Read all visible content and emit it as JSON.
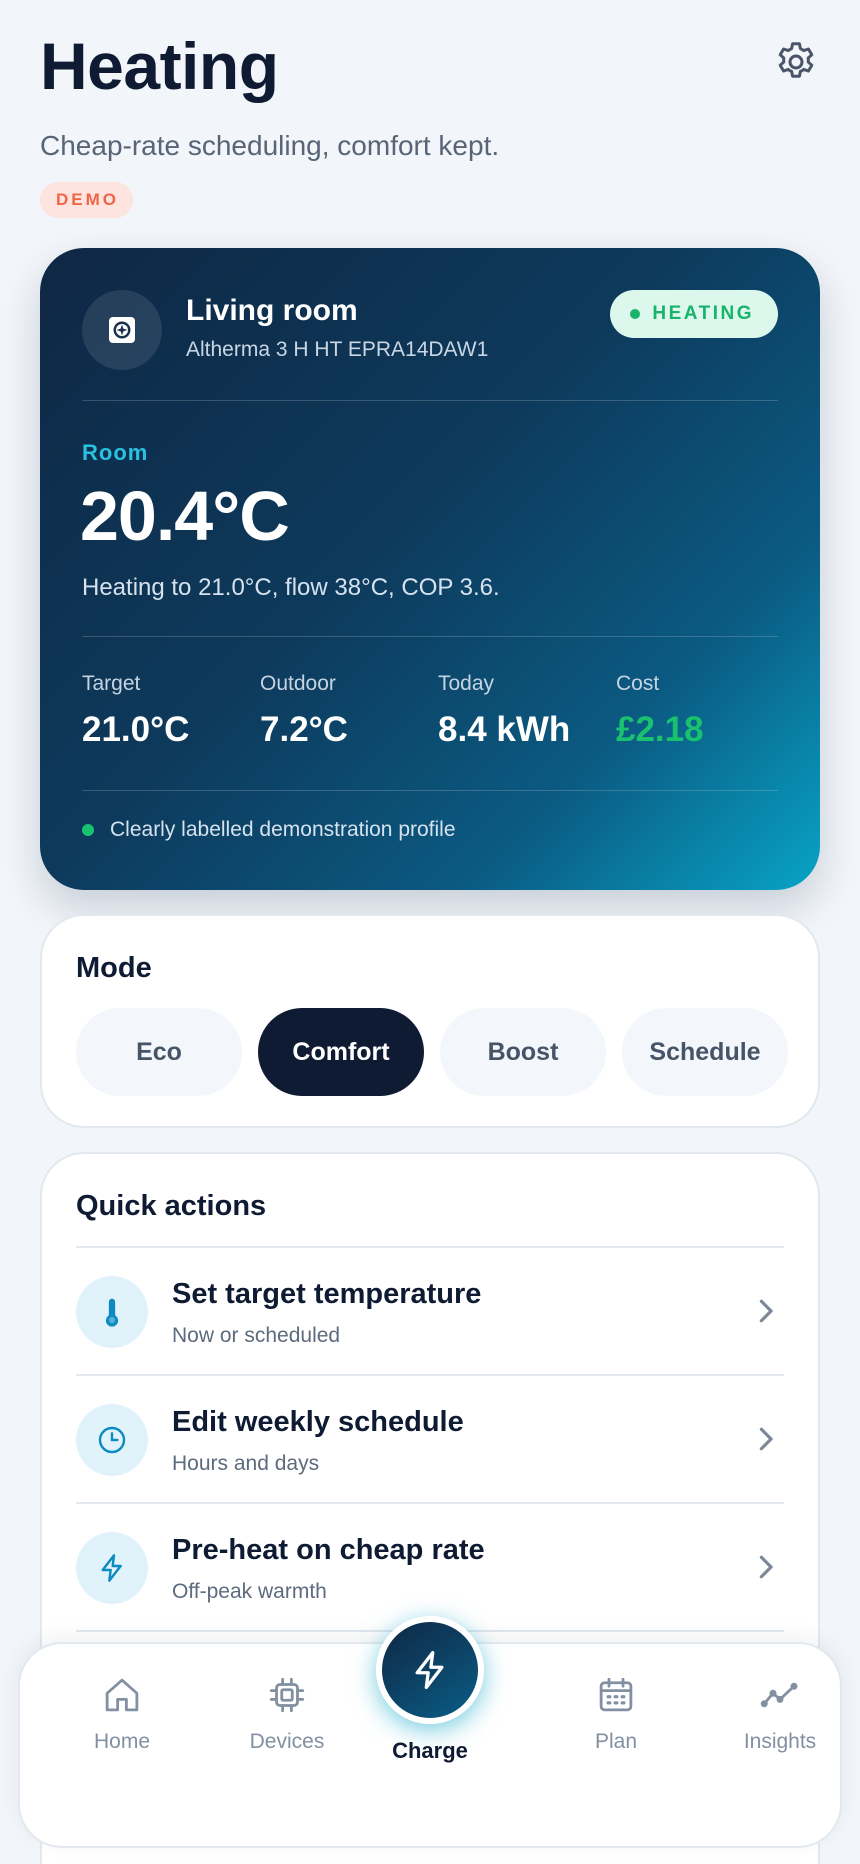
{
  "header": {
    "title": "Heating",
    "subtitle": "Cheap-rate scheduling, comfort kept.",
    "badge": "DEMO",
    "settings_icon": "gear-icon"
  },
  "hero": {
    "device_icon": "heat-pump-icon",
    "device_name": "Living room",
    "device_model": "Altherma 3 H HT EPRA14DAW1",
    "status": "HEATING",
    "room_label": "Room",
    "room_temp": "20.4°C",
    "room_description": "Heating to 21.0°C, flow 38°C, COP 3.6.",
    "stats": [
      {
        "label": "Target",
        "value": "21.0°C"
      },
      {
        "label": "Outdoor",
        "value": "7.2°C"
      },
      {
        "label": "Today",
        "value": "8.4 kWh"
      },
      {
        "label": "Cost",
        "value": "£2.18"
      }
    ],
    "footnote": "Clearly labelled demonstration profile",
    "colors": {
      "status": "#19b36b",
      "cost": "#19c26f",
      "room_label": "#2bc0de"
    }
  },
  "mode": {
    "title": "Mode",
    "options": [
      "Eco",
      "Comfort",
      "Boost",
      "Schedule"
    ],
    "selected": "Comfort"
  },
  "quick_actions": {
    "title": "Quick actions",
    "items": [
      {
        "title": "Set target temperature",
        "subtitle": "Now or scheduled",
        "icon": "thermometer-icon"
      },
      {
        "title": "Edit weekly schedule",
        "subtitle": "Hours and days",
        "icon": "clock-icon"
      },
      {
        "title": "Pre-heat on cheap rate",
        "subtitle": "Off-peak warmth",
        "icon": "lightning-icon"
      }
    ]
  },
  "nav": {
    "items": [
      {
        "label": "Home",
        "icon": "home-icon"
      },
      {
        "label": "Devices",
        "icon": "chip-icon"
      },
      {
        "label": "Charge",
        "icon": "lightning-icon"
      },
      {
        "label": "Plan",
        "icon": "calendar-icon"
      },
      {
        "label": "Insights",
        "icon": "trend-icon"
      }
    ],
    "active": "Charge"
  }
}
